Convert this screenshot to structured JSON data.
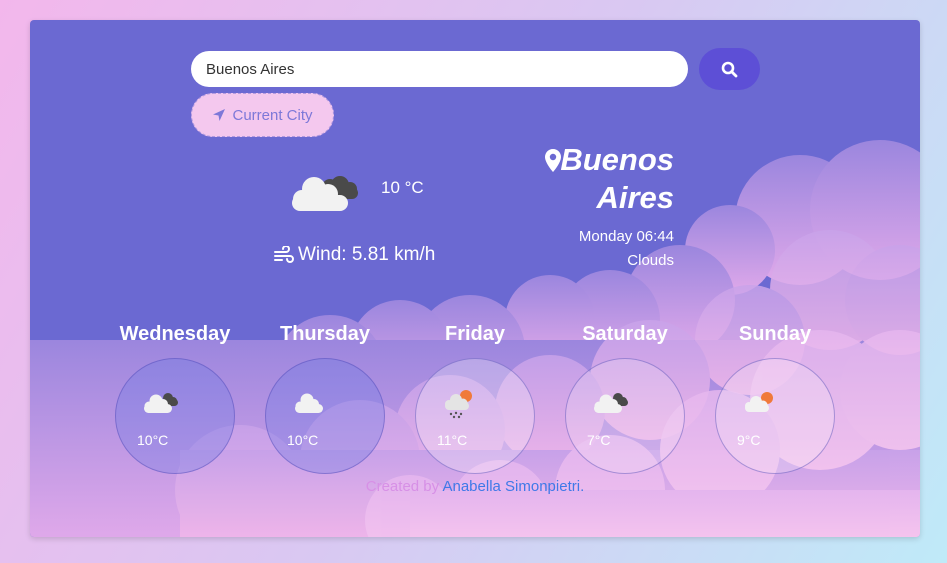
{
  "search": {
    "value": "Buenos Aires",
    "button_icon": "search-icon"
  },
  "current_city_button": {
    "label": "Current City",
    "icon": "location-arrow-icon"
  },
  "current": {
    "icon": "dark-clouds-icon",
    "temperature": "10 °C",
    "wind": "Wind: 5.81 km/h",
    "city_line1": "Buenos",
    "city_line2": "Aires",
    "date": "Monday 06:44",
    "description": "Clouds"
  },
  "forecast": [
    {
      "day": "Wednesday",
      "temp": "10°C",
      "icon": "dark-clouds-icon"
    },
    {
      "day": "Thursday",
      "temp": "10°C",
      "icon": "cloud-icon"
    },
    {
      "day": "Friday",
      "temp": "11°C",
      "icon": "rain-sun-cloud-icon"
    },
    {
      "day": "Saturday",
      "temp": "7°C",
      "icon": "dark-clouds-icon"
    },
    {
      "day": "Sunday",
      "temp": "9°C",
      "icon": "sun-cloud-icon"
    }
  ],
  "footer": {
    "prefix": "Created by",
    "link": "Anabella Simonpietri."
  },
  "colors": {
    "card": "#6b69d2",
    "search_button": "#5d4fd6",
    "current_button": "#f4c8ee",
    "link": "#3f79e8"
  }
}
